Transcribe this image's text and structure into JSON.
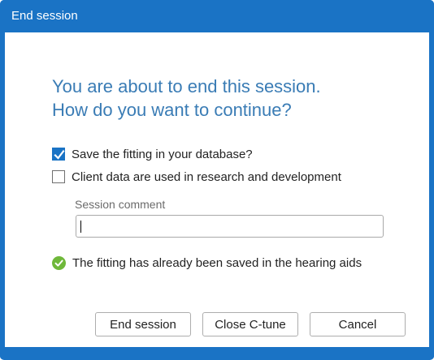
{
  "window": {
    "title": "End session"
  },
  "message": {
    "line1": "You are about to end this session.",
    "line2": "How do you want to continue?"
  },
  "options": [
    {
      "label": "Save the fitting in your database?",
      "checked": true
    },
    {
      "label": "Client data are used in research and development",
      "checked": false
    }
  ],
  "comment": {
    "label": "Session comment",
    "value": ""
  },
  "status": {
    "icon": "check-circle-icon",
    "text": "The fitting has already been saved in the hearing aids",
    "color": "#6fb83a"
  },
  "buttons": {
    "end_session": "End session",
    "close_app": "Close C-tune",
    "cancel": "Cancel"
  },
  "colors": {
    "accent": "#1a73c5",
    "heading": "#3a7cb5"
  }
}
